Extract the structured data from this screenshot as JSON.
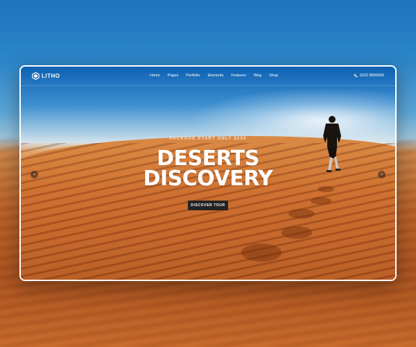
{
  "brand": {
    "name": "LITHO"
  },
  "nav": {
    "items": [
      {
        "label": "Home"
      },
      {
        "label": "Pages"
      },
      {
        "label": "Portfolio"
      },
      {
        "label": "Elements"
      },
      {
        "label": "Features"
      },
      {
        "label": "Blog"
      },
      {
        "label": "Shop"
      }
    ],
    "phone": "0222 8899900"
  },
  "hero": {
    "subtitle": "PACKAGE START ONLY $250",
    "title_line1": "DESERTS",
    "title_line2": "DISCOVERY",
    "cta_label": "DISCOVER TOUR"
  },
  "slider": {
    "prev_icon": "chevron-left-icon",
    "next_icon": "chevron-right-icon"
  },
  "colors": {
    "sky": "#1f74bd",
    "sand": "#c8692b",
    "button": "#232323",
    "text": "#ffffff"
  }
}
